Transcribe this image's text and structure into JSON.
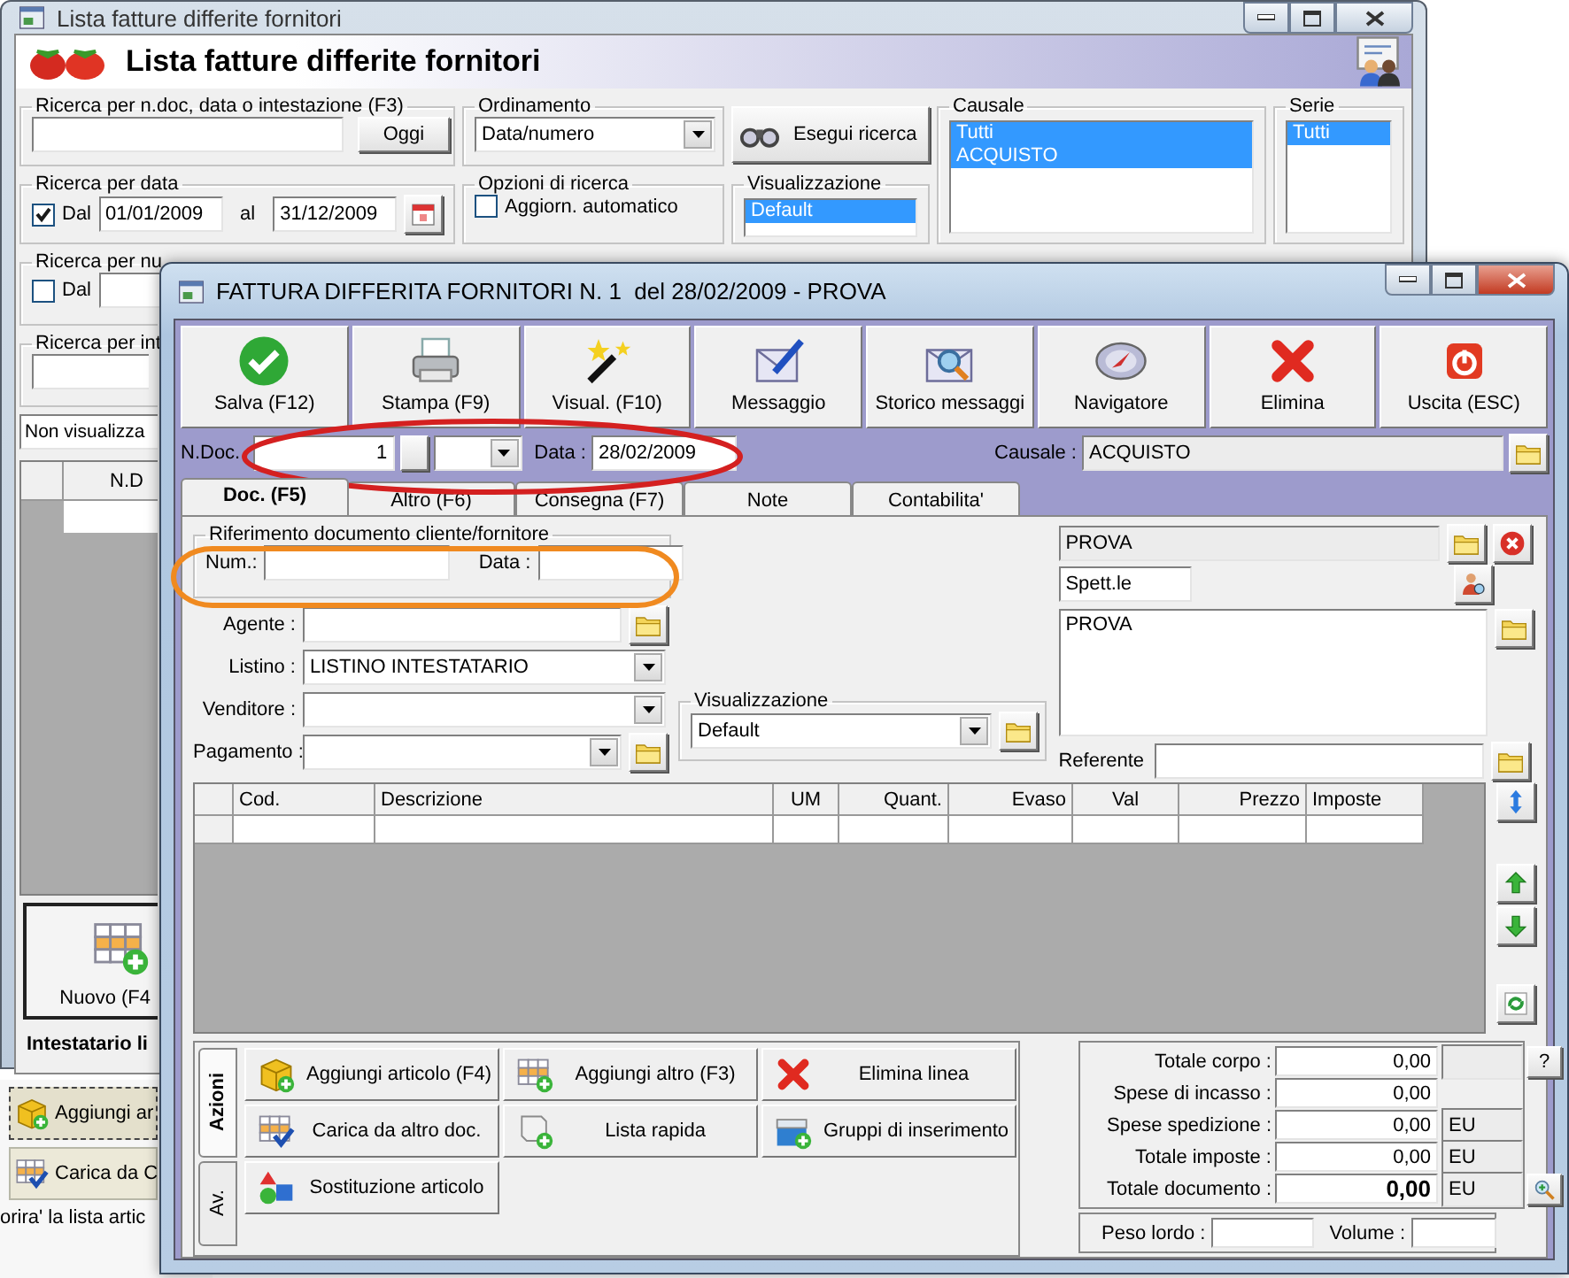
{
  "background_window": {
    "title": "Lista fatture differite fornitori",
    "heading": "Lista fatture differite fornitori",
    "text_search": {
      "label": "Ricerca per n.doc, data o intestazione (F3)",
      "button": "Oggi"
    },
    "sort": {
      "label": "Ordinamento",
      "value": "Data/numero"
    },
    "search_button": "Esegui ricerca",
    "reason": {
      "label": "Causale",
      "items": [
        {
          "label": "Tutti",
          "selected": true
        },
        {
          "label": "ACQUISTO",
          "selected": true
        }
      ]
    },
    "series": {
      "label": "Serie",
      "items": [
        {
          "label": "Tutti",
          "selected": true
        }
      ]
    },
    "date_search": {
      "label": "Ricerca per data",
      "checked": true,
      "from_label": "Dal",
      "from": "01/01/2009",
      "to_label": "al",
      "to": "31/12/2009"
    },
    "search_options": {
      "label": "Opzioni di ricerca",
      "items": [
        {
          "label": "Aggiorn. automatico",
          "checked": false
        }
      ]
    },
    "view": {
      "label": "Visualizzazione",
      "items": [
        {
          "label": "Default",
          "selected": true
        }
      ]
    },
    "number_search": {
      "label": "Ricerca per nu",
      "checked": false,
      "from_label": "Dal"
    },
    "holder_search": {
      "label": "Ricerca per int"
    },
    "filter": {
      "value": "Non visualizza"
    },
    "table": {
      "columns": [
        "N.D"
      ]
    },
    "new_button": "Nuovo (F4",
    "footer": "Intestatario li"
  },
  "underlying_panel": {
    "buttons": [
      {
        "label": "Aggiungi ar",
        "focused": true
      },
      {
        "label": "Carica da C",
        "focused": false
      }
    ],
    "hint": "orira' la lista artic"
  },
  "document_window": {
    "title": "FATTURA DIFFERITA FORNITORI N. 1  del 28/02/2009 - PROVA",
    "toolbar": [
      "Salva (F12)",
      "Stampa (F9)",
      "Visual. (F10)",
      "Messaggio",
      "Storico messaggi",
      "Navigatore",
      "Elimina",
      "Uscita (ESC)"
    ],
    "doc_number": {
      "label": "N.Doc.",
      "value": "1"
    },
    "date": {
      "label": "Data :",
      "value": "28/02/2009"
    },
    "reason": {
      "label": "Causale :",
      "value": "ACQUISTO"
    },
    "tabs": [
      {
        "label": "Doc. (F5)",
        "selected": true
      },
      {
        "label": "Altro (F6)",
        "selected": false
      },
      {
        "label": "Consegna (F7)",
        "selected": false
      },
      {
        "label": "Note",
        "selected": false
      },
      {
        "label": "Contabilita'",
        "selected": false
      }
    ],
    "reference": {
      "label": "Riferimento documento cliente/fornitore",
      "number_label": "Num.:",
      "date_label": "Data :"
    },
    "agent": {
      "label": "Agente :"
    },
    "price_list": {
      "label": "Listino :",
      "value": "LISTINO INTESTATARIO"
    },
    "seller": {
      "label": "Venditore :"
    },
    "payment": {
      "label": "Pagamento :"
    },
    "view": {
      "label": "Visualizzazione",
      "value": "Default"
    },
    "holder": {
      "name": "PROVA",
      "title": "Spett.le",
      "address": "PROVA",
      "contact_label": "Referente"
    },
    "lines_table": {
      "columns": [
        "Cod.",
        "Descrizione",
        "UM",
        "Quant.",
        "Evaso",
        "Val",
        "Prezzo",
        "Imposte"
      ]
    },
    "action_tabs": [
      {
        "label": "Azioni",
        "selected": true
      },
      {
        "label": "Av.",
        "selected": false
      }
    ],
    "actions": [
      "Aggiungi articolo (F4)",
      "Aggiungi altro (F3)",
      "Elimina linea",
      "Carica da altro doc.",
      "Lista rapida",
      "Gruppi di inserimento",
      "Sostituzione articolo"
    ],
    "totals": [
      {
        "label": "Totale corpo :",
        "value": "0,00",
        "kind": "help"
      },
      {
        "label": "Spese di incasso :",
        "value": "0,00",
        "kind": "plain"
      },
      {
        "label": "Spese spedizione :",
        "value": "0,00",
        "currency": "EU",
        "kind": "plain"
      },
      {
        "label": "Totale imposte :",
        "value": "0,00",
        "currency": "EU",
        "kind": "plain"
      },
      {
        "label": "Totale documento :",
        "value": "0,00",
        "currency": "EU",
        "kind": "grand"
      }
    ],
    "help_button": "?",
    "weight": {
      "label": "Peso lordo :"
    },
    "volume": {
      "label": "Volume :"
    },
    "annotations": [
      {
        "kind": "ellipse",
        "color": "#d42020"
      },
      {
        "kind": "ellipse",
        "color": "#f08a20"
      }
    ]
  }
}
